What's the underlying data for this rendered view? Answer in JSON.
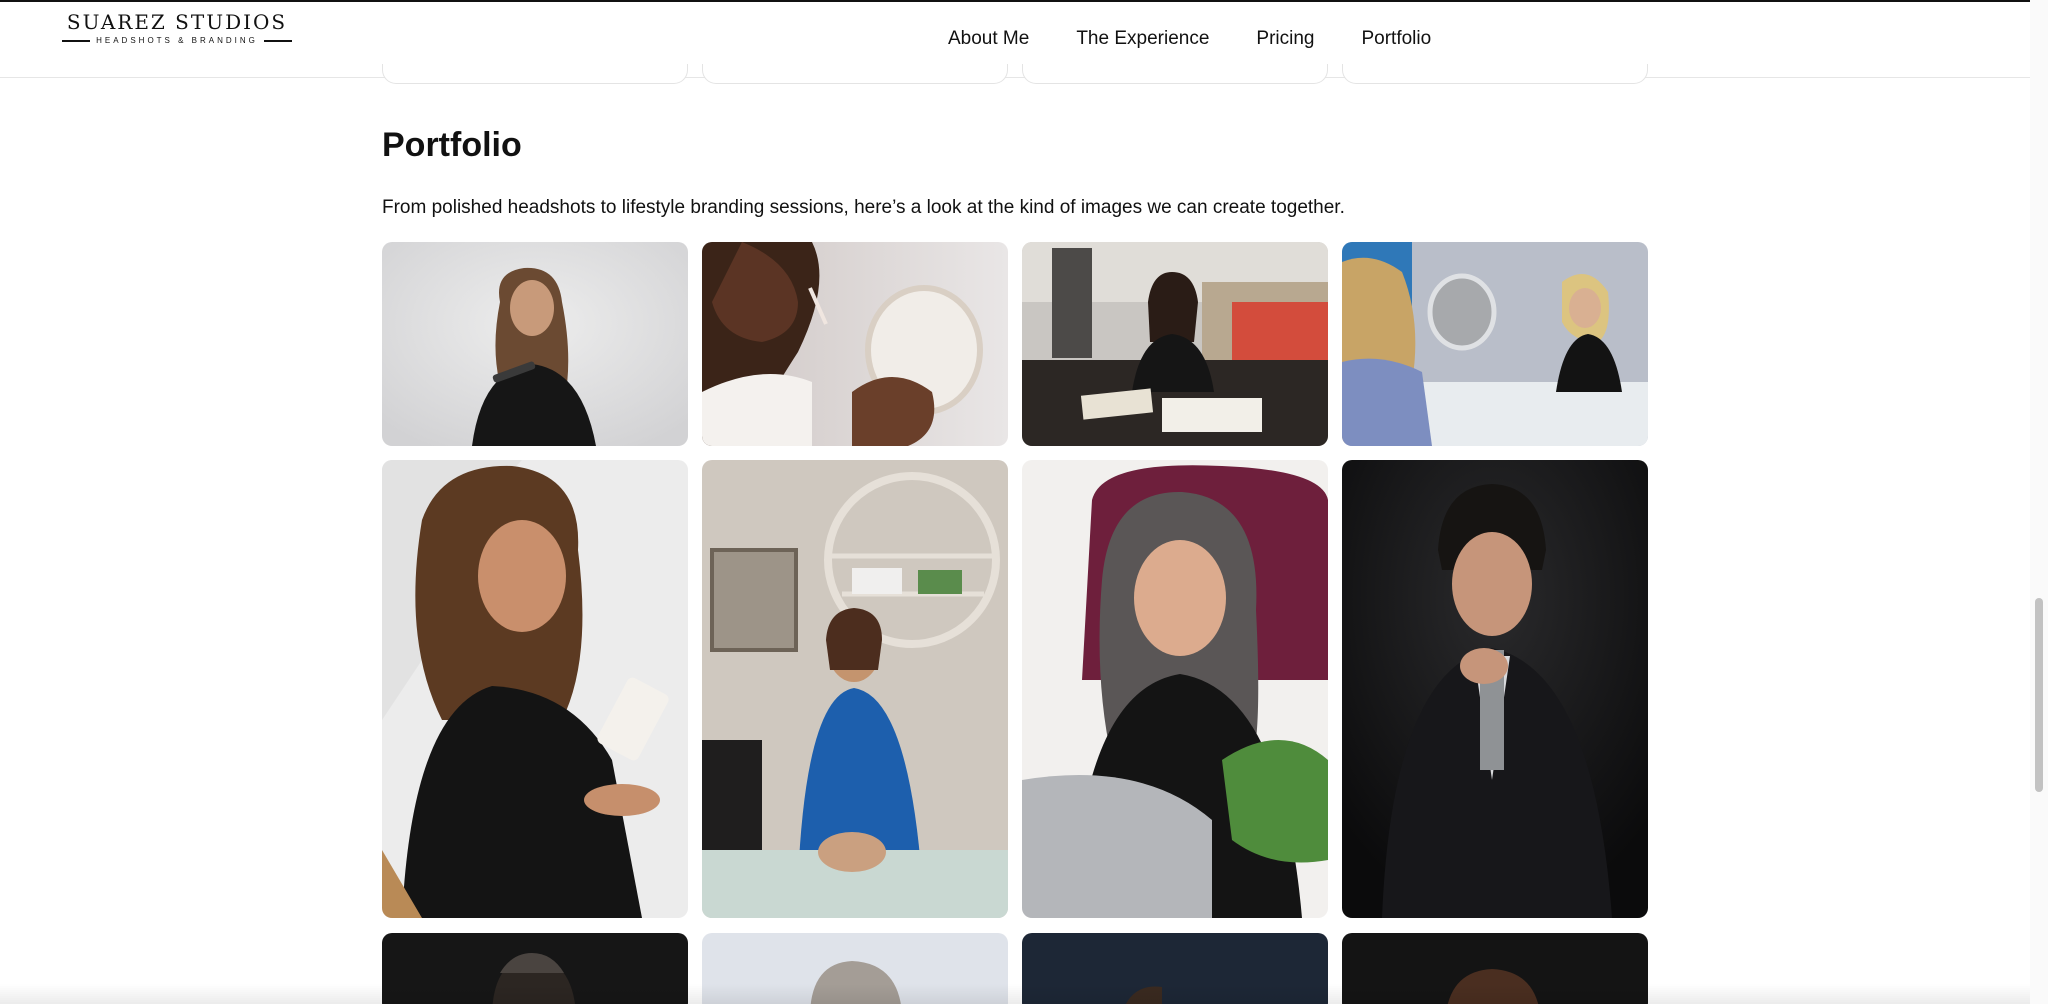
{
  "brand": {
    "name": "SUAREZ STUDIOS",
    "tagline": "HEADSHOTS & BRANDING"
  },
  "nav": {
    "items": [
      {
        "label": "About Me"
      },
      {
        "label": "The Experience"
      },
      {
        "label": "Pricing"
      },
      {
        "label": "Portfolio"
      }
    ]
  },
  "portfolio": {
    "title": "Portfolio",
    "description": "From polished headshots to lifestyle branding sessions, here’s a look at the kind of images we can create together."
  },
  "gallery": {
    "row1": [
      "portfolio-photo-woman-holding-pen",
      "portfolio-photo-lipgloss-mirror",
      "portfolio-photo-designer-at-desk",
      "portfolio-photo-consultation-table"
    ],
    "row2": [
      "portfolio-photo-woman-with-lotion",
      "portfolio-photo-aesthetician-treatment",
      "portfolio-photo-woman-with-laptop",
      "portfolio-photo-man-in-suit"
    ],
    "row3": [
      "portfolio-photo-dark-portrait",
      "portfolio-photo-gray-haired-portrait",
      "portfolio-photo-navy-portrait",
      "portfolio-photo-dark-portrait-2"
    ]
  },
  "colors": {
    "text": "#111111",
    "background": "#ffffff",
    "border": "#e6e6e6"
  }
}
